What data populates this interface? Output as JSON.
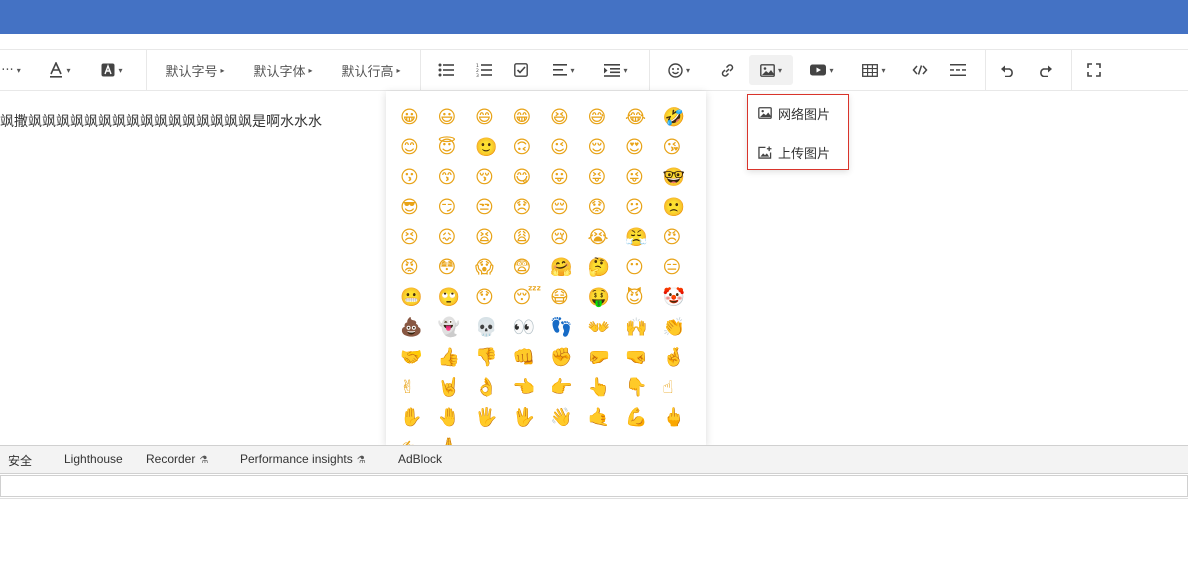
{
  "toolbar": {
    "more_label": "···",
    "font_size_label": "默认字号",
    "font_family_label": "默认字体",
    "line_height_label": "默认行高"
  },
  "editor": {
    "content": "飒撒飒飒飒飒飒飒飒飒飒飒飒飒飒飒飒飒是啊水水水"
  },
  "emoji_panel": {
    "emojis": [
      "😀",
      "😃",
      "😄",
      "😁",
      "😆",
      "😅",
      "😂",
      "🤣",
      "😊",
      "😇",
      "🙂",
      "🙃",
      "😉",
      "😌",
      "😍",
      "😘",
      "😗",
      "😙",
      "😚",
      "😋",
      "😛",
      "😝",
      "😜",
      "🤓",
      "😎",
      "😏",
      "😒",
      "😞",
      "😔",
      "😟",
      "😕",
      "🙁",
      "😣",
      "😖",
      "😫",
      "😩",
      "😢",
      "😭",
      "😤",
      "😠",
      "😡",
      "😳",
      "😱",
      "😨",
      "🤗",
      "🤔",
      "😶",
      "😑",
      "😬",
      "🙄",
      "😯",
      "😴",
      "😷",
      "🤑",
      "😈",
      "🤡",
      "💩",
      "👻",
      "💀",
      "👀",
      "👣",
      "👐",
      "🙌",
      "👏",
      "🤝",
      "👍",
      "👎",
      "👊",
      "✊",
      "🤛",
      "🤜",
      "🤞",
      "✌",
      "🤘",
      "👌",
      "👈",
      "👉",
      "👆",
      "👇",
      "☝",
      "✋",
      "🤚",
      "🖐",
      "🖖",
      "👋",
      "🤙",
      "💪",
      "🖕",
      "✍",
      "🙏"
    ]
  },
  "image_menu": {
    "items": [
      {
        "label": "网络图片"
      },
      {
        "label": "上传图片"
      }
    ]
  },
  "devtools": {
    "tabs": [
      {
        "label": "安全"
      },
      {
        "label": "Lighthouse"
      },
      {
        "label": "Recorder"
      },
      {
        "label": "Performance insights"
      },
      {
        "label": "AdBlock"
      }
    ]
  }
}
